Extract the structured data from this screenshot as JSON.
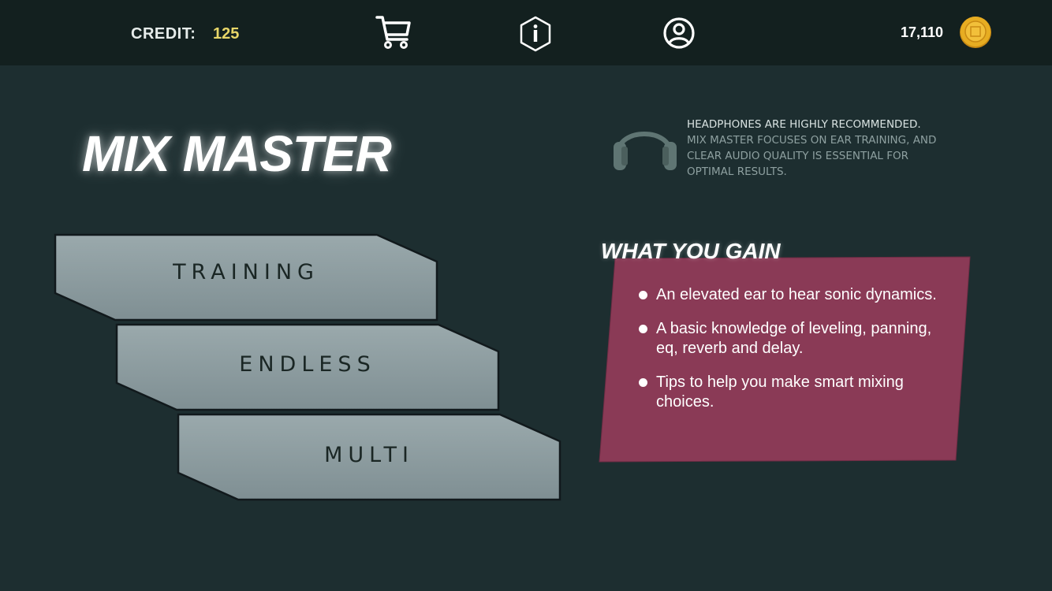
{
  "topbar": {
    "credit_label": "CREDIT:",
    "credit_value": "125",
    "coins": "17,110",
    "icons": [
      "cart-icon",
      "info-icon",
      "user-icon",
      "coin-icon"
    ]
  },
  "title": "MIX MASTER",
  "notice": {
    "heading": "HEADPHONES ARE HIGHLY RECOMMENDED.",
    "body": "MIX MASTER FOCUSES ON EAR TRAINING, AND CLEAR AUDIO QUALITY IS ESSENTIAL FOR OPTIMAL RESULTS.",
    "icon": "headphones-icon"
  },
  "modes": {
    "training": "TRAINING",
    "endless": "ENDLESS",
    "multi": "MULTI"
  },
  "gain": {
    "title": "WHAT YOU GAIN",
    "items": [
      "An elevated ear to hear sonic dynamics.",
      "A basic knowledge of leveling, panning, eq, reverb and delay.",
      "Tips to help you make smart mixing choices."
    ]
  },
  "colors": {
    "background": "#1d2e30",
    "topbar": "#13201f",
    "credit_value": "#e8d668",
    "button_fill": "#8e9ea1",
    "panel": "#8a3a56",
    "coin": "#e0a51e"
  }
}
